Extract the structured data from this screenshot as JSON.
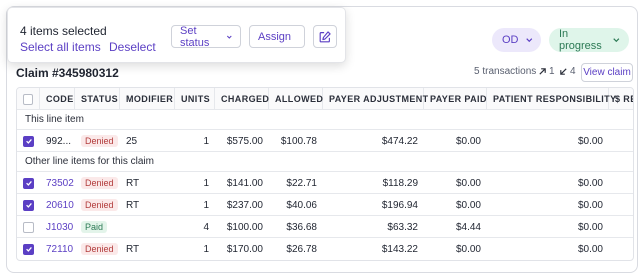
{
  "selection": {
    "count_label": "4 items selected",
    "select_all_label": "Select all items",
    "deselect_label": "Deselect",
    "set_status_label": "Set status",
    "assign_label": "Assign",
    "edit_icon": "edit-icon"
  },
  "pills": {
    "od_label": "OD",
    "status_label": "In progress"
  },
  "claim": {
    "title": "Claim #345980312",
    "transactions_label": "5 transactions",
    "up_count": "1",
    "down_count": "4",
    "view_claim_label": "View claim"
  },
  "table": {
    "headers": {
      "code": "CODE",
      "status": "STATUS",
      "modifier": "MODIFIER",
      "units": "UNITS",
      "charged": "CHARGED",
      "allowed": "ALLOWED",
      "payer_adjustment": "PAYER ADJUSTMENT",
      "payer_paid": "PAYER PAID",
      "patient_responsibility": "PATIENT RESPONSIBILITY",
      "dollar_re": "$ RE"
    },
    "group_this_line": "This line item",
    "group_other_lines": "Other line items for this claim",
    "rows": [
      {
        "checked": true,
        "code": "992...",
        "code_is_link": false,
        "status": "Denied",
        "modifier": "25",
        "units": "1",
        "charged": "$575.00",
        "allowed": "$100.78",
        "payer_adjustment": "$474.22",
        "payer_paid": "$0.00",
        "patient_responsibility": "$0.00"
      },
      {
        "checked": true,
        "code": "73502",
        "code_is_link": true,
        "status": "Denied",
        "modifier": "RT",
        "units": "1",
        "charged": "$141.00",
        "allowed": "$22.71",
        "payer_adjustment": "$118.29",
        "payer_paid": "$0.00",
        "patient_responsibility": "$0.00"
      },
      {
        "checked": true,
        "code": "20610",
        "code_is_link": true,
        "status": "Denied",
        "modifier": "RT",
        "units": "1",
        "charged": "$237.00",
        "allowed": "$40.06",
        "payer_adjustment": "$196.94",
        "payer_paid": "$0.00",
        "patient_responsibility": "$0.00"
      },
      {
        "checked": false,
        "code": "J1030",
        "code_is_link": true,
        "status": "Paid",
        "modifier": "",
        "units": "4",
        "charged": "$100.00",
        "allowed": "$36.68",
        "payer_adjustment": "$63.32",
        "payer_paid": "$4.44",
        "patient_responsibility": "$0.00"
      },
      {
        "checked": true,
        "code": "72110",
        "code_is_link": true,
        "status": "Denied",
        "modifier": "RT",
        "units": "1",
        "charged": "$170.00",
        "allowed": "$26.78",
        "payer_adjustment": "$143.22",
        "payer_paid": "$0.00",
        "patient_responsibility": "$0.00"
      }
    ]
  },
  "colors": {
    "accent": "#5b3fc4",
    "denied_text": "#b23b3b",
    "denied_bg": "#fbe9e9",
    "paid_text": "#2c7a55",
    "paid_bg": "#e3f4ea",
    "od_pill_bg": "#ece8fb",
    "progress_pill_bg": "#dff5ea"
  }
}
